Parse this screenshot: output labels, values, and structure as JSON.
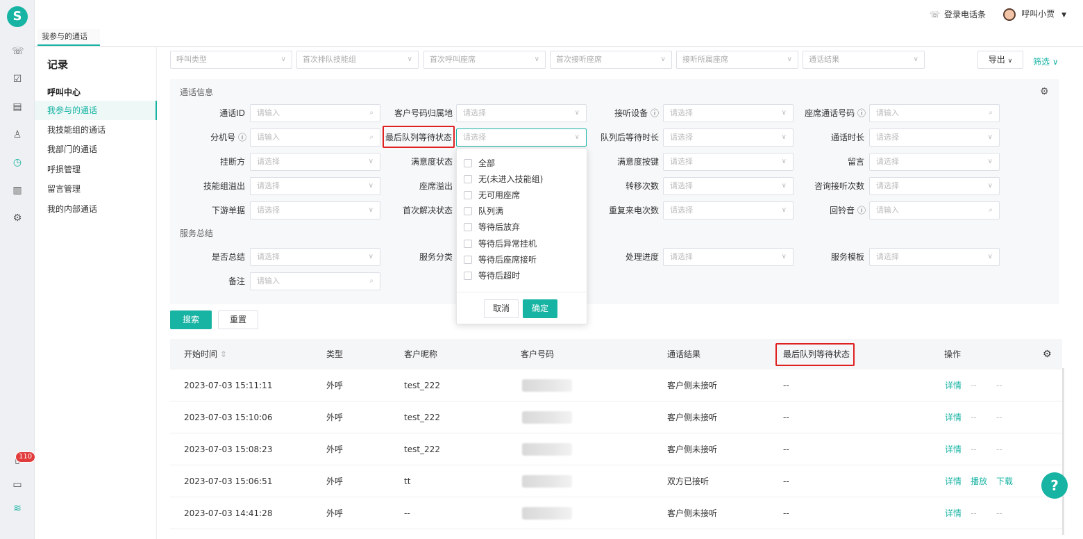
{
  "brand": {
    "logo_letter": "S",
    "accent": "#17b3a3"
  },
  "rail": {
    "badge_count": "110"
  },
  "topbar": {
    "login_label": "登录电话条",
    "user_name": "呼叫小贾"
  },
  "tabs": [
    {
      "label": "我参与的通话",
      "close": "×"
    }
  ],
  "leftnav": {
    "title": "记录",
    "group": "呼叫中心",
    "items": [
      {
        "label": "我参与的通话",
        "active": true
      },
      {
        "label": "我技能组的通话"
      },
      {
        "label": "我部门的通话"
      },
      {
        "label": "呼损管理"
      },
      {
        "label": "留言管理"
      },
      {
        "label": "我的内部通话"
      }
    ]
  },
  "filterbar": {
    "selects": [
      "呼叫类型",
      "首次排队技能组",
      "首次呼叫座席",
      "首次接听座席",
      "接听所属座席",
      "通话结果"
    ],
    "export_label": "导出",
    "filter_label": "筛选"
  },
  "form": {
    "section_call": "通话信息",
    "section_service": "服务总结",
    "placeholder_input": "请输入",
    "placeholder_select": "请选择",
    "fields": [
      {
        "label": "通话ID",
        "type": "input"
      },
      {
        "label": "客户号码归属地",
        "type": "select"
      },
      {
        "label": "接听设备",
        "type": "select",
        "info": true
      },
      {
        "label": "座席通话号码",
        "type": "input",
        "info": true
      },
      {
        "label": "分机号",
        "type": "input",
        "info": true
      },
      {
        "label": "最后队列等待状态",
        "type": "select",
        "highlight": true
      },
      {
        "label": "队列后等待时长",
        "type": "select"
      },
      {
        "label": "通话时长",
        "type": "select"
      },
      {
        "label": "挂断方",
        "type": "select"
      },
      {
        "label": "满意度状态",
        "type": "select"
      },
      {
        "label": "满意度按键",
        "type": "select"
      },
      {
        "label": "留言",
        "type": "select"
      },
      {
        "label": "技能组溢出",
        "type": "select"
      },
      {
        "label": "座席溢出",
        "type": "select"
      },
      {
        "label": "转移次数",
        "type": "select"
      },
      {
        "label": "咨询接听次数",
        "type": "select"
      },
      {
        "label": "下游单据",
        "type": "select"
      },
      {
        "label": "首次解决状态",
        "type": "select"
      },
      {
        "label": "重复来电次数",
        "type": "select"
      },
      {
        "label": "回铃音",
        "type": "input",
        "info": true
      }
    ],
    "service_fields": [
      {
        "label": "是否总结",
        "type": "select"
      },
      {
        "label": "服务分类",
        "type": "select"
      },
      {
        "label": "处理进度",
        "type": "select"
      },
      {
        "label": "服务模板",
        "type": "select"
      },
      {
        "label": "备注",
        "type": "input"
      }
    ]
  },
  "actions": {
    "search_label": "搜索",
    "reset_label": "重置"
  },
  "dropdown": {
    "options": [
      "全部",
      "无(未进入技能组)",
      "无可用座席",
      "队列满",
      "等待后放弃",
      "等待后异常挂机",
      "等待后座席接听",
      "等待后超时"
    ],
    "cancel_label": "取消",
    "ok_label": "确定"
  },
  "table": {
    "columns": [
      "开始时间",
      "类型",
      "客户昵称",
      "客户号码",
      "通话结果",
      "最后队列等待状态",
      "操作"
    ],
    "sort_icon": "⇕",
    "rows": [
      {
        "start": "2023-07-03 15:11:11",
        "type": "外呼",
        "nick": "test_222",
        "result": "客户侧未接听",
        "queue": "--",
        "ops": [
          "详情",
          "--",
          "--"
        ]
      },
      {
        "start": "2023-07-03 15:10:06",
        "type": "外呼",
        "nick": "test_222",
        "result": "客户侧未接听",
        "queue": "--",
        "ops": [
          "详情",
          "--",
          "--"
        ]
      },
      {
        "start": "2023-07-03 15:08:23",
        "type": "外呼",
        "nick": "test_222",
        "result": "客户侧未接听",
        "queue": "--",
        "ops": [
          "详情",
          "--",
          "--"
        ]
      },
      {
        "start": "2023-07-03 15:06:51",
        "type": "外呼",
        "nick": "tt",
        "result": "双方已接听",
        "queue": "--",
        "ops": [
          "详情",
          "播放",
          "下载"
        ]
      },
      {
        "start": "2023-07-03 14:41:28",
        "type": "外呼",
        "nick": "--",
        "result": "客户侧未接听",
        "queue": "--",
        "ops": [
          "详情",
          "--",
          "--"
        ]
      }
    ]
  },
  "help_label": "?"
}
